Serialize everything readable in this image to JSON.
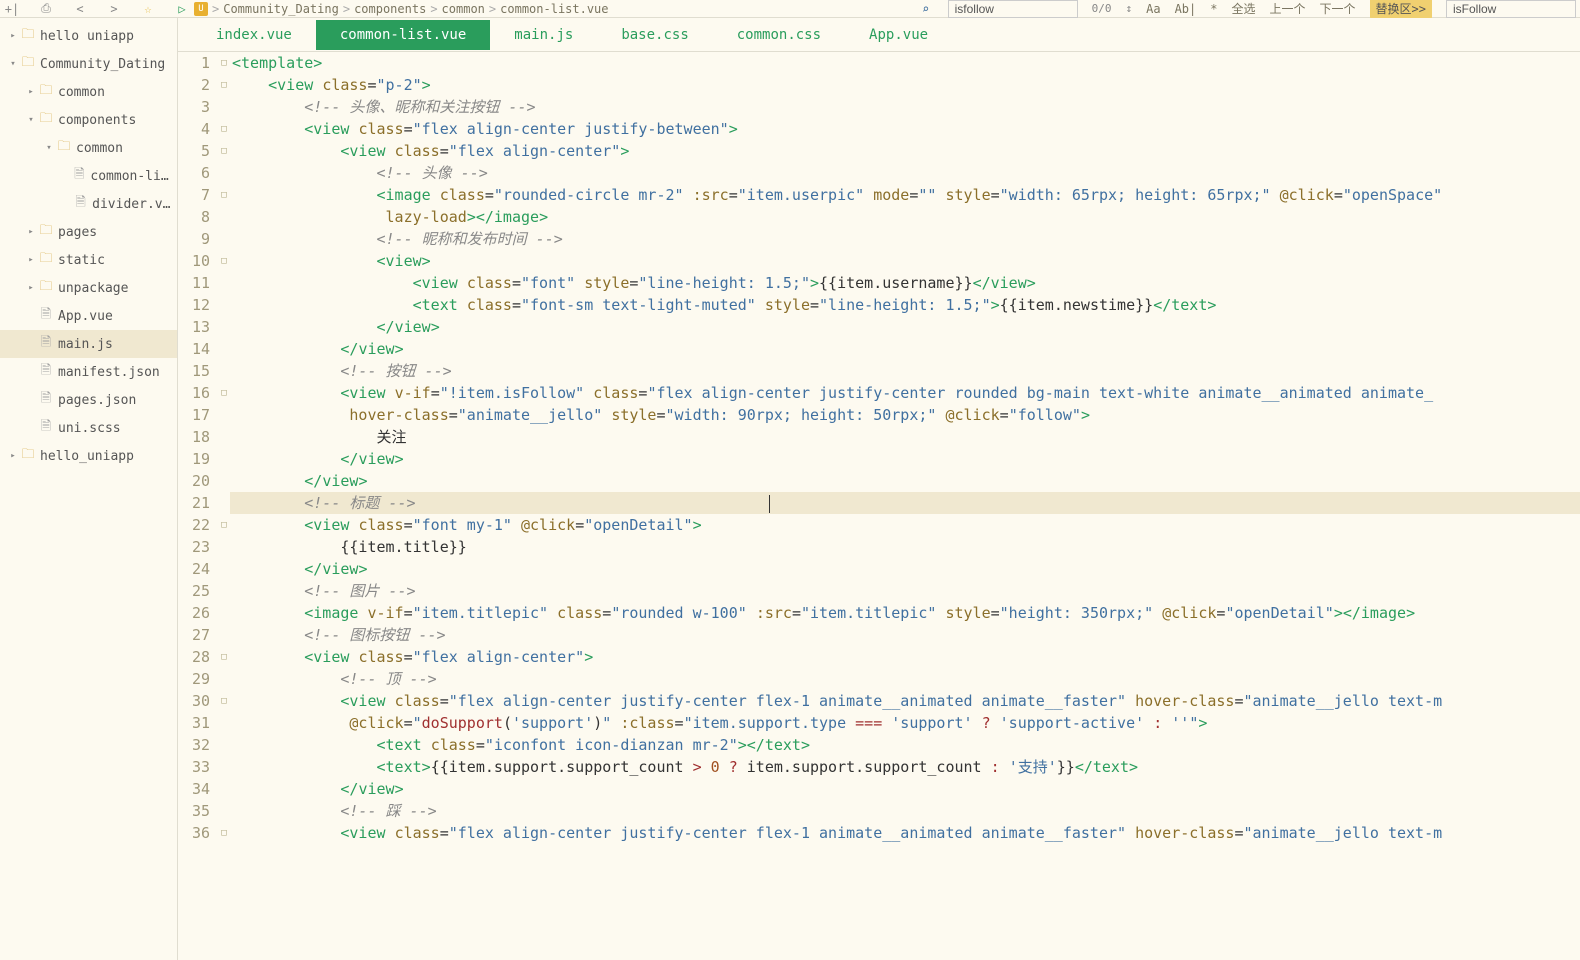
{
  "toolbar": {
    "breadcrumb": [
      "Community_Dating",
      "components",
      "common",
      "common-list.vue"
    ],
    "search_value": "isfollow",
    "count": "0/0",
    "labels": [
      "Aa",
      "Ab|",
      "*",
      "全选",
      "上一个",
      "下一个",
      "替换区>>"
    ],
    "right_input": "isFollow"
  },
  "tree": [
    {
      "indent": 0,
      "arrow": "▸",
      "icon": "folder",
      "label": "hello uniapp"
    },
    {
      "indent": 0,
      "arrow": "▾",
      "icon": "folder",
      "label": "Community_Dating"
    },
    {
      "indent": 1,
      "arrow": "▸",
      "icon": "folder",
      "label": "common"
    },
    {
      "indent": 1,
      "arrow": "▾",
      "icon": "folder",
      "label": "components"
    },
    {
      "indent": 2,
      "arrow": "▾",
      "icon": "folder",
      "label": "common"
    },
    {
      "indent": 3,
      "arrow": "",
      "icon": "file",
      "label": "common-li..."
    },
    {
      "indent": 3,
      "arrow": "",
      "icon": "file",
      "label": "divider.vue"
    },
    {
      "indent": 1,
      "arrow": "▸",
      "icon": "folder",
      "label": "pages"
    },
    {
      "indent": 1,
      "arrow": "▸",
      "icon": "folder",
      "label": "static"
    },
    {
      "indent": 1,
      "arrow": "▸",
      "icon": "folder",
      "label": "unpackage"
    },
    {
      "indent": 1,
      "arrow": "",
      "icon": "file",
      "label": "App.vue"
    },
    {
      "indent": 1,
      "arrow": "",
      "icon": "file",
      "label": "main.js",
      "selected": true
    },
    {
      "indent": 1,
      "arrow": "",
      "icon": "file",
      "label": "manifest.json"
    },
    {
      "indent": 1,
      "arrow": "",
      "icon": "file",
      "label": "pages.json"
    },
    {
      "indent": 1,
      "arrow": "",
      "icon": "file",
      "label": "uni.scss"
    },
    {
      "indent": 0,
      "arrow": "▸",
      "icon": "folder",
      "label": "hello_uniapp"
    }
  ],
  "tabs": [
    {
      "label": "index.vue"
    },
    {
      "label": "common-list.vue",
      "active": true
    },
    {
      "label": "main.js"
    },
    {
      "label": "base.css"
    },
    {
      "label": "common.css"
    },
    {
      "label": "App.vue"
    }
  ],
  "code": {
    "lines": [
      {
        "n": 1,
        "fold": "□",
        "html": "<span class='punc'>&lt;</span><span class='tag'>template</span><span class='punc'>&gt;</span>"
      },
      {
        "n": 2,
        "fold": "□",
        "html": "    <span class='punc'>&lt;</span><span class='tag'>view</span> <span class='attr'>class</span>=<span class='str'>\"p-2\"</span><span class='punc'>&gt;</span>"
      },
      {
        "n": 3,
        "fold": "",
        "html": "        <span class='comment'>&lt;!-- 头像、昵称和关注按钮 --&gt;</span>"
      },
      {
        "n": 4,
        "fold": "□",
        "html": "        <span class='punc'>&lt;</span><span class='tag'>view</span> <span class='attr'>class</span>=<span class='str'>\"flex align-center justify-between\"</span><span class='punc'>&gt;</span>"
      },
      {
        "n": 5,
        "fold": "□",
        "html": "            <span class='punc'>&lt;</span><span class='tag'>view</span> <span class='attr'>class</span>=<span class='str'>\"flex align-center\"</span><span class='punc'>&gt;</span>"
      },
      {
        "n": 6,
        "fold": "",
        "html": "                <span class='comment'>&lt;!-- 头像 --&gt;</span>"
      },
      {
        "n": 7,
        "fold": "□",
        "html": "                <span class='punc'>&lt;</span><span class='tag'>image</span> <span class='attr'>class</span>=<span class='str'>\"rounded-circle mr-2\"</span> <span class='attr'>:src</span>=<span class='str'>\"item.userpic\"</span> <span class='attr'>mode</span>=<span class='str'>\"\"</span> <span class='attr'>style</span>=<span class='str'>\"width: 65rpx; height: 65rpx;\"</span> <span class='event'>@click</span>=<span class='str'>\"openSpace\"</span>"
      },
      {
        "n": 8,
        "fold": "",
        "html": "                 <span class='attr'>lazy-load</span><span class='punc'>&gt;&lt;/</span><span class='tag'>image</span><span class='punc'>&gt;</span>"
      },
      {
        "n": 9,
        "fold": "",
        "html": "                <span class='comment'>&lt;!-- 昵称和发布时间 --&gt;</span>"
      },
      {
        "n": 10,
        "fold": "□",
        "html": "                <span class='punc'>&lt;</span><span class='tag'>view</span><span class='punc'>&gt;</span>"
      },
      {
        "n": 11,
        "fold": "",
        "html": "                    <span class='punc'>&lt;</span><span class='tag'>view</span> <span class='attr'>class</span>=<span class='str'>\"font\"</span> <span class='attr'>style</span>=<span class='str'>\"line-height: 1.5;\"</span><span class='punc'>&gt;</span><span class='mustache'>{{item.username}}</span><span class='punc'>&lt;/</span><span class='tag'>view</span><span class='punc'>&gt;</span>"
      },
      {
        "n": 12,
        "fold": "",
        "html": "                    <span class='punc'>&lt;</span><span class='tag'>text</span> <span class='attr'>class</span>=<span class='str'>\"font-sm text-light-muted\"</span> <span class='attr'>style</span>=<span class='str'>\"line-height: 1.5;\"</span><span class='punc'>&gt;</span><span class='mustache'>{{item.newstime}}</span><span class='punc'>&lt;/</span><span class='tag'>text</span><span class='punc'>&gt;</span>"
      },
      {
        "n": 13,
        "fold": "",
        "html": "                <span class='punc'>&lt;/</span><span class='tag'>view</span><span class='punc'>&gt;</span>"
      },
      {
        "n": 14,
        "fold": "",
        "html": "            <span class='punc'>&lt;/</span><span class='tag'>view</span><span class='punc'>&gt;</span>"
      },
      {
        "n": 15,
        "fold": "",
        "html": "            <span class='comment'>&lt;!-- 按钮 --&gt;</span>"
      },
      {
        "n": 16,
        "fold": "□",
        "html": "            <span class='punc'>&lt;</span><span class='tag'>view</span> <span class='attr'>v-if</span>=<span class='str'>\"!item.isFollow\"</span> <span class='attr'>class</span>=<span class='str'>\"flex align-center justify-center rounded bg-main text-white animate__animated animate_</span>"
      },
      {
        "n": 17,
        "fold": "",
        "html": "             <span class='attr'>hover-class</span>=<span class='str'>\"animate__jello\"</span> <span class='attr'>style</span>=<span class='str'>\"width: 90rpx; height: 50rpx;\"</span> <span class='event'>@click</span>=<span class='str'>\"follow\"</span><span class='punc'>&gt;</span>"
      },
      {
        "n": 18,
        "fold": "",
        "html": "                关注"
      },
      {
        "n": 19,
        "fold": "",
        "html": "            <span class='punc'>&lt;/</span><span class='tag'>view</span><span class='punc'>&gt;</span>"
      },
      {
        "n": 20,
        "fold": "",
        "html": "        <span class='punc'>&lt;/</span><span class='tag'>view</span><span class='punc'>&gt;</span>"
      },
      {
        "n": 21,
        "fold": "",
        "hl": true,
        "html": "        <span class='comment'>&lt;!-- 标题 --&gt;</span>                                       <span class='cursor'></span>"
      },
      {
        "n": 22,
        "fold": "□",
        "html": "        <span class='punc'>&lt;</span><span class='tag'>view</span> <span class='attr'>class</span>=<span class='str'>\"font my-1\"</span> <span class='event'>@click</span>=<span class='str'>\"openDetail\"</span><span class='punc'>&gt;</span>"
      },
      {
        "n": 23,
        "fold": "",
        "html": "            <span class='mustache'>{{item.title}}</span>"
      },
      {
        "n": 24,
        "fold": "",
        "html": "        <span class='punc'>&lt;/</span><span class='tag'>view</span><span class='punc'>&gt;</span>"
      },
      {
        "n": 25,
        "fold": "",
        "html": "        <span class='comment'>&lt;!-- 图片 --&gt;</span>"
      },
      {
        "n": 26,
        "fold": "",
        "html": "        <span class='punc'>&lt;</span><span class='tag'>image</span> <span class='attr'>v-if</span>=<span class='str'>\"item.titlepic\"</span> <span class='attr'>class</span>=<span class='str'>\"rounded w-100\"</span> <span class='attr'>:src</span>=<span class='str'>\"item.titlepic\"</span> <span class='attr'>style</span>=<span class='str'>\"height: 350rpx;\"</span> <span class='event'>@click</span>=<span class='str'>\"openDetail\"</span><span class='punc'>&gt;&lt;/</span><span class='tag'>image</span><span class='punc'>&gt;</span>"
      },
      {
        "n": 27,
        "fold": "",
        "html": "        <span class='comment'>&lt;!-- 图标按钮 --&gt;</span>"
      },
      {
        "n": 28,
        "fold": "□",
        "html": "        <span class='punc'>&lt;</span><span class='tag'>view</span> <span class='attr'>class</span>=<span class='str'>\"flex align-center\"</span><span class='punc'>&gt;</span>"
      },
      {
        "n": 29,
        "fold": "",
        "html": "            <span class='comment'>&lt;!-- 顶 --&gt;</span>"
      },
      {
        "n": 30,
        "fold": "□",
        "html": "            <span class='punc'>&lt;</span><span class='tag'>view</span> <span class='attr'>class</span>=<span class='str'>\"flex align-center justify-center flex-1 animate__animated animate__faster\"</span> <span class='attr'>hover-class</span>=<span class='str'>\"animate__jello text-m</span>"
      },
      {
        "n": 31,
        "fold": "",
        "html": "             <span class='event'>@click</span>=<span class='str'>\"</span><span class='js-kw'>doSupport</span>(<span class='js-str'>'support'</span>)<span class='str'>\"</span> <span class='attr'>:class</span>=<span class='str'>\"item.support.type </span><span class='js-op'>===</span><span class='str'> </span><span class='js-str'>'support'</span><span class='str'> </span><span class='js-op'>?</span><span class='str'> </span><span class='js-str'>'support-active'</span><span class='str'> </span><span class='js-op'>:</span><span class='str'> </span><span class='js-str'>''</span><span class='str'>\"</span><span class='punc'>&gt;</span>"
      },
      {
        "n": 32,
        "fold": "",
        "html": "                <span class='punc'>&lt;</span><span class='tag'>text</span> <span class='attr'>class</span>=<span class='str'>\"iconfont icon-dianzan mr-2\"</span><span class='punc'>&gt;&lt;/</span><span class='tag'>text</span><span class='punc'>&gt;</span>"
      },
      {
        "n": 33,
        "fold": "",
        "html": "                <span class='punc'>&lt;</span><span class='tag'>text</span><span class='punc'>&gt;</span><span class='mustache'>{{item.support.support_count </span><span class='js-op'>&gt;</span><span class='mustache'> </span><span class='js-num'>0</span><span class='mustache'> </span><span class='js-op'>?</span><span class='mustache'> item.support.support_count </span><span class='js-op'>:</span><span class='mustache'> </span><span class='js-str'>'支持'</span><span class='mustache'>}}</span><span class='punc'>&lt;/</span><span class='tag'>text</span><span class='punc'>&gt;</span>"
      },
      {
        "n": 34,
        "fold": "",
        "html": "            <span class='punc'>&lt;/</span><span class='tag'>view</span><span class='punc'>&gt;</span>"
      },
      {
        "n": 35,
        "fold": "",
        "html": "            <span class='comment'>&lt;!-- 踩 --&gt;</span>"
      },
      {
        "n": 36,
        "fold": "□",
        "html": "            <span class='punc'>&lt;</span><span class='tag'>view</span> <span class='attr'>class</span>=<span class='str'>\"flex align-center justify-center flex-1 animate__animated animate__faster\"</span> <span class='attr'>hover-class</span>=<span class='str'>\"animate__jello text-m</span>"
      }
    ]
  }
}
